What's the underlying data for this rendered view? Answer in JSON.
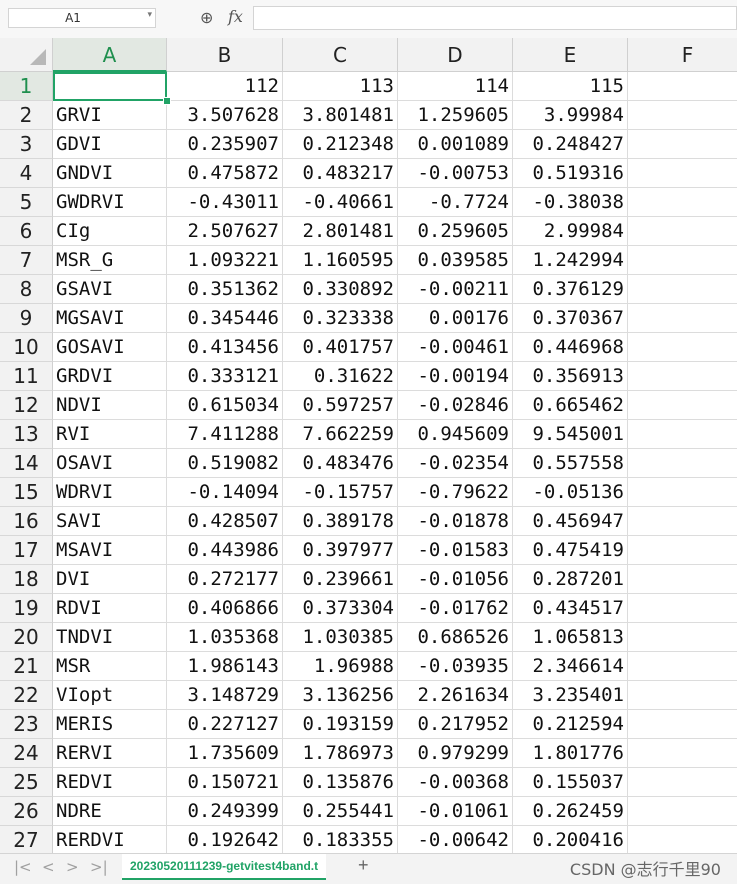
{
  "formula_bar": {
    "name_box": "A1",
    "fx_label": "fx",
    "formula_value": "",
    "zoom_icon": "zoom-icon",
    "dropdown_icon": "chevron-down-icon"
  },
  "columns": [
    "A",
    "B",
    "C",
    "D",
    "E",
    "F"
  ],
  "active_cell": "A1",
  "accent_color": "#21a366",
  "rows": [
    {
      "n": "1",
      "a": "",
      "b": "112",
      "c": "113",
      "d": "114",
      "e": "115"
    },
    {
      "n": "2",
      "a": "GRVI",
      "b": "3.507628",
      "c": "3.801481",
      "d": "1.259605",
      "e": "3.99984"
    },
    {
      "n": "3",
      "a": "GDVI",
      "b": "0.235907",
      "c": "0.212348",
      "d": "0.001089",
      "e": "0.248427"
    },
    {
      "n": "4",
      "a": "GNDVI",
      "b": "0.475872",
      "c": "0.483217",
      "d": "-0.00753",
      "e": "0.519316"
    },
    {
      "n": "5",
      "a": "GWDRVI",
      "b": "-0.43011",
      "c": "-0.40661",
      "d": "-0.7724",
      "e": "-0.38038"
    },
    {
      "n": "6",
      "a": "CIg",
      "b": "2.507627",
      "c": "2.801481",
      "d": "0.259605",
      "e": "2.99984"
    },
    {
      "n": "7",
      "a": "MSR_G",
      "b": "1.093221",
      "c": "1.160595",
      "d": "0.039585",
      "e": "1.242994"
    },
    {
      "n": "8",
      "a": "GSAVI",
      "b": "0.351362",
      "c": "0.330892",
      "d": "-0.00211",
      "e": "0.376129"
    },
    {
      "n": "9",
      "a": "MGSAVI",
      "b": "0.345446",
      "c": "0.323338",
      "d": "0.00176",
      "e": "0.370367"
    },
    {
      "n": "10",
      "a": "GOSAVI",
      "b": "0.413456",
      "c": "0.401757",
      "d": "-0.00461",
      "e": "0.446968"
    },
    {
      "n": "11",
      "a": "GRDVI",
      "b": "0.333121",
      "c": "0.31622",
      "d": "-0.00194",
      "e": "0.356913"
    },
    {
      "n": "12",
      "a": "NDVI",
      "b": "0.615034",
      "c": "0.597257",
      "d": "-0.02846",
      "e": "0.665462"
    },
    {
      "n": "13",
      "a": "RVI",
      "b": "7.411288",
      "c": "7.662259",
      "d": "0.945609",
      "e": "9.545001"
    },
    {
      "n": "14",
      "a": "OSAVI",
      "b": "0.519082",
      "c": "0.483476",
      "d": "-0.02354",
      "e": "0.557558"
    },
    {
      "n": "15",
      "a": "WDRVI",
      "b": "-0.14094",
      "c": "-0.15757",
      "d": "-0.79622",
      "e": "-0.05136"
    },
    {
      "n": "16",
      "a": "SAVI",
      "b": "0.428507",
      "c": "0.389178",
      "d": "-0.01878",
      "e": "0.456947"
    },
    {
      "n": "17",
      "a": "MSAVI",
      "b": "0.443986",
      "c": "0.397977",
      "d": "-0.01583",
      "e": "0.475419"
    },
    {
      "n": "18",
      "a": "DVI",
      "b": "0.272177",
      "c": "0.239661",
      "d": "-0.01056",
      "e": "0.287201"
    },
    {
      "n": "19",
      "a": "RDVI",
      "b": "0.406866",
      "c": "0.373304",
      "d": "-0.01762",
      "e": "0.434517"
    },
    {
      "n": "20",
      "a": "TNDVI",
      "b": "1.035368",
      "c": "1.030385",
      "d": "0.686526",
      "e": "1.065813"
    },
    {
      "n": "21",
      "a": "MSR",
      "b": "1.986143",
      "c": "1.96988",
      "d": "-0.03935",
      "e": "2.346614"
    },
    {
      "n": "22",
      "a": "VIopt",
      "b": "3.148729",
      "c": "3.136256",
      "d": "2.261634",
      "e": "3.235401"
    },
    {
      "n": "23",
      "a": "MERIS",
      "b": "0.227127",
      "c": "0.193159",
      "d": "0.217952",
      "e": "0.212594"
    },
    {
      "n": "24",
      "a": "RERVI",
      "b": "1.735609",
      "c": "1.786973",
      "d": "0.979299",
      "e": "1.801776"
    },
    {
      "n": "25",
      "a": "REDVI",
      "b": "0.150721",
      "c": "0.135876",
      "d": "-0.00368",
      "e": "0.155037"
    },
    {
      "n": "26",
      "a": "NDRE",
      "b": "0.249399",
      "c": "0.255441",
      "d": "-0.01061",
      "e": "0.262459"
    },
    {
      "n": "27",
      "a": "RERDVI",
      "b": "0.192642",
      "c": "0.183355",
      "d": "-0.00642",
      "e": "0.200416"
    }
  ],
  "sheet_bar": {
    "nav": [
      "|<",
      "<",
      ">",
      ">|"
    ],
    "active_sheet": "20230520111239-getvitest4band.t",
    "add_sheet": "+",
    "watermark": "CSDN @志行千里90"
  }
}
